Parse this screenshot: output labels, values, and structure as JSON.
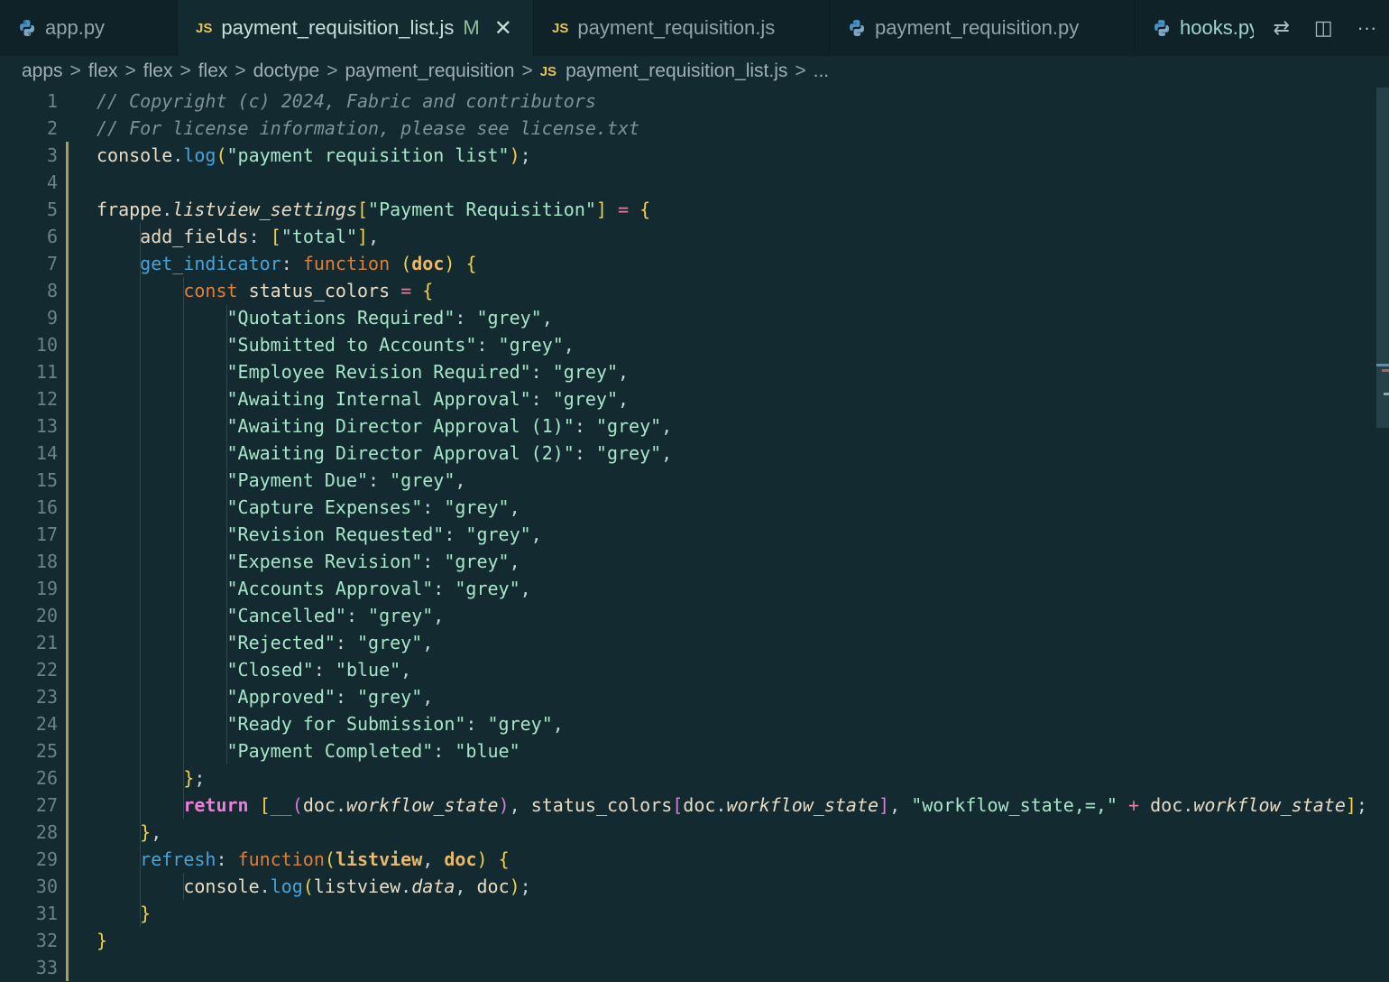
{
  "tabs": [
    {
      "label": "app.py",
      "icon": "python-icon",
      "active": false
    },
    {
      "label": "payment_requisition_list.js",
      "icon": "js-icon",
      "active": true,
      "modified": "M",
      "close": "✕"
    },
    {
      "label": "payment_requisition.js",
      "icon": "js-icon",
      "active": false
    },
    {
      "label": "payment_requisition.py",
      "icon": "python-icon",
      "active": false
    },
    {
      "label": "hooks.py",
      "icon": "python-icon",
      "active": false
    }
  ],
  "tab_actions": {
    "compare_icon": "⇄",
    "split_icon": "◫",
    "more": "···"
  },
  "js_badge": "JS",
  "breadcrumb": [
    "apps",
    "flex",
    "flex",
    "flex",
    "doctype",
    "payment_requisition",
    "payment_requisition_list.js",
    "..."
  ],
  "breadcrumb_sep": ">",
  "code_lines": [
    "// Copyright (c) 2024, Fabric and contributors",
    "// For license information, please see license.txt",
    "console.log(\"payment requisition list\");",
    "",
    "frappe.listview_settings[\"Payment Requisition\"] = {",
    "    add_fields: [\"total\"],",
    "    get_indicator: function (doc) {",
    "        const status_colors = {",
    "            \"Quotations Required\": \"grey\",",
    "            \"Submitted to Accounts\": \"grey\",",
    "            \"Employee Revision Required\": \"grey\",",
    "            \"Awaiting Internal Approval\": \"grey\",",
    "            \"Awaiting Director Approval (1)\": \"grey\",",
    "            \"Awaiting Director Approval (2)\": \"grey\",",
    "            \"Payment Due\": \"grey\",",
    "            \"Capture Expenses\": \"grey\",",
    "            \"Revision Requested\": \"grey\",",
    "            \"Expense Revision\": \"grey\",",
    "            \"Accounts Approval\": \"grey\",",
    "            \"Cancelled\": \"grey\",",
    "            \"Rejected\": \"grey\",",
    "            \"Closed\": \"blue\",",
    "            \"Approved\": \"grey\",",
    "            \"Ready for Submission\": \"grey\",",
    "            \"Payment Completed\": \"blue\"",
    "        };",
    "        return [__(doc.workflow_state), status_colors[doc.workflow_state], \"workflow_state,=,\" + doc.workflow_state];",
    "    },",
    "    refresh: function(listview, doc) {",
    "        console.log(listview.data, doc);",
    "    }",
    "}",
    ""
  ],
  "colors": {
    "background": "#132a30",
    "tabbar": "#0f2228",
    "string": "#a8e6c8",
    "keyword": "#e07f3a",
    "modified_gutter": "#b49a4a"
  }
}
